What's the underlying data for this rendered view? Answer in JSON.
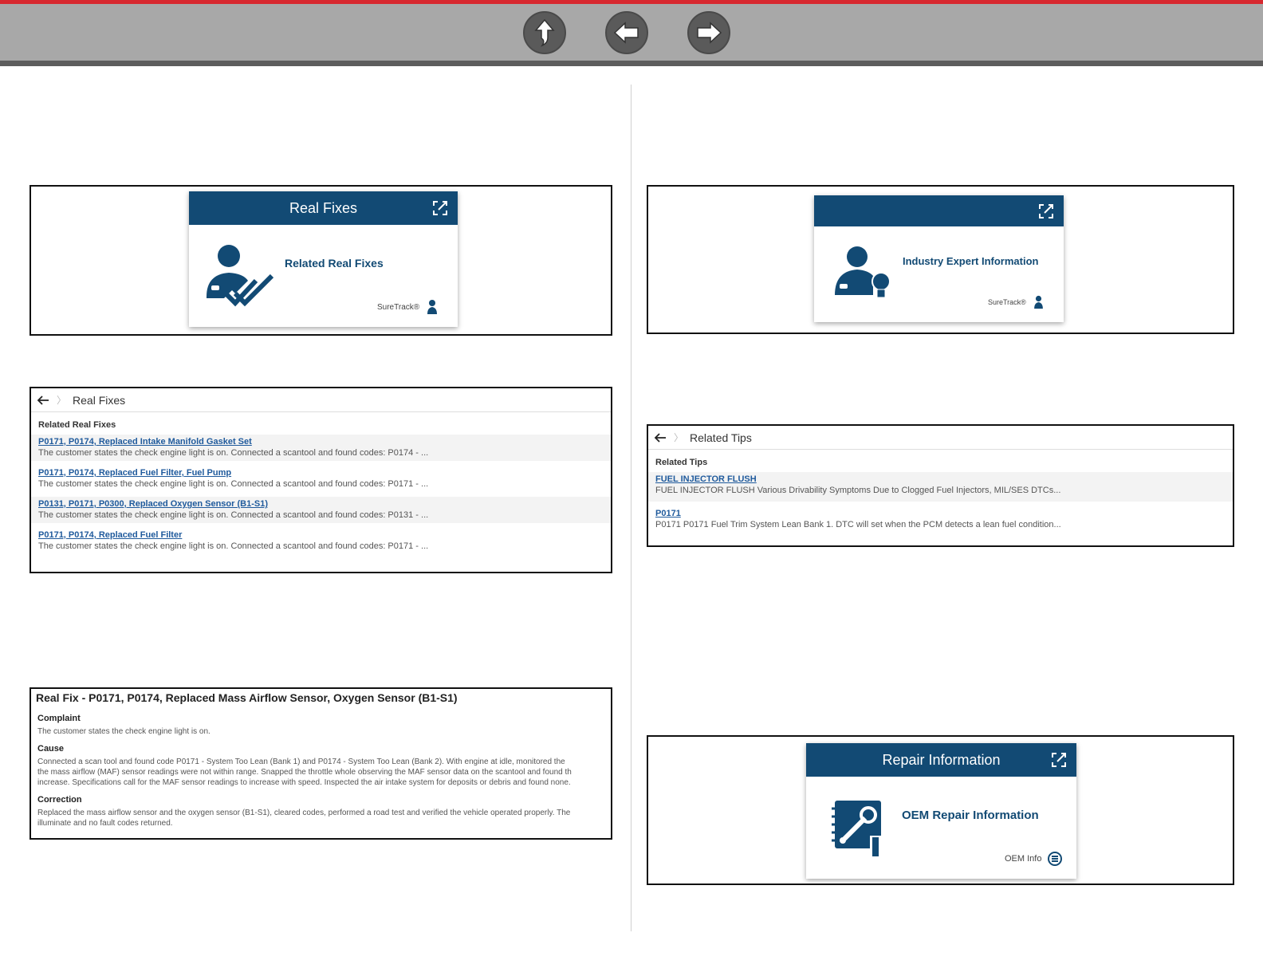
{
  "nav": {
    "home_icon": "up-arrow-icon",
    "back_icon": "left-arrow-icon",
    "forward_icon": "right-arrow-icon"
  },
  "colors": {
    "brand": "#124a74",
    "topbar_red": "#d7282f",
    "link": "#1f5a9c"
  },
  "real_fixes_card": {
    "header": "Real Fixes",
    "title": "Related Real Fixes",
    "footer": "SureTrack®"
  },
  "real_fixes_list": {
    "breadcrumb": "Real Fixes",
    "section": "Related Real Fixes",
    "items": [
      {
        "link": "P0171, P0174, Replaced Intake Manifold Gasket Set",
        "desc": "The customer states the check engine light is on.  Connected a scantool and found codes: P0174 - ..."
      },
      {
        "link": "P0171, P0174, Replaced Fuel Filter, Fuel Pump",
        "desc": "The customer states the check engine light is on.  Connected a scantool and found codes: P0171 - ..."
      },
      {
        "link": "P0131, P0171, P0300, Replaced Oxygen Sensor (B1-S1)",
        "desc": "The customer states the check engine light is on.  Connected a scantool and found codes: P0131 - ..."
      },
      {
        "link": "P0171, P0174, Replaced Fuel Filter",
        "desc": "The customer states the check engine light is on.  Connected a scantool and found codes: P0171 - ..."
      }
    ]
  },
  "real_fix_detail": {
    "title": "Real Fix - P0171, P0174, Replaced Mass Airflow Sensor, Oxygen Sensor (B1-S1)",
    "complaint_label": "Complaint",
    "complaint": "The customer states the check engine light is on.",
    "cause_label": "Cause",
    "cause_1": "Connected a scan tool and found code P0171 - System Too Lean (Bank 1) and P0174 - System Too Lean (Bank 2).  With engine at idle, monitored the",
    "cause_2": "the mass airflow (MAF) sensor readings were not within range. Snapped the throttle whole observing the MAF sensor data on the scantool and found th",
    "cause_3": "increase. Specifications call for the MAF sensor readings to increase with speed. Inspected the air intake system for deposits or debris and found none.",
    "correction_label": "Correction",
    "correction_1": "Replaced the mass airflow sensor and the oxygen sensor (B1-S1), cleared codes, performed a road test and verified the vehicle operated properly. The",
    "correction_2": "illuminate and no fault codes returned."
  },
  "expert_card": {
    "header": "",
    "title": "Industry Expert Information",
    "footer": "SureTrack®"
  },
  "tips_list": {
    "breadcrumb": "Related Tips",
    "section": "Related Tips",
    "items": [
      {
        "link": "FUEL INJECTOR FLUSH",
        "desc": "FUEL INJECTOR FLUSH Various Drivability Symptoms Due to Clogged Fuel Injectors, MIL/SES DTCs..."
      },
      {
        "link": "P0171",
        "desc": "P0171 P0171 Fuel Trim System Lean Bank 1. DTC will set when the PCM detects a lean fuel condition..."
      }
    ]
  },
  "repair_card": {
    "header": "Repair Information",
    "title": "OEM Repair Information",
    "footer": "OEM Info"
  }
}
